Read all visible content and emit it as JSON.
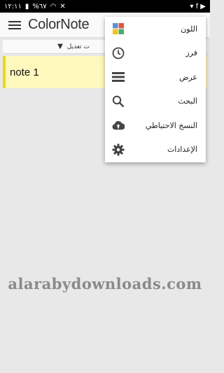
{
  "statusbar": {
    "time": "١٢:١١",
    "battery": "%٦٧",
    "left_icons": "▾ f ▶"
  },
  "appbar": {
    "logo_color": "Color",
    "logo_note": "Note"
  },
  "sortbar": {
    "label": "ت تعديل",
    "arrow": "▼"
  },
  "notes": [
    {
      "title": "note 1",
      "color": "#fff8bd"
    }
  ],
  "menu": {
    "items": [
      {
        "label": "اللون",
        "icon": "color-grid-icon"
      },
      {
        "label": "فرز",
        "icon": "clock-icon"
      },
      {
        "label": "عرض",
        "icon": "list-view-icon"
      },
      {
        "label": "البحث",
        "icon": "search-icon"
      },
      {
        "label": "النسخ الاحتياطي",
        "icon": "cloud-upload-icon"
      },
      {
        "label": "الإعدادات",
        "icon": "gear-icon"
      }
    ]
  },
  "watermark": "alarabydownloads.com"
}
